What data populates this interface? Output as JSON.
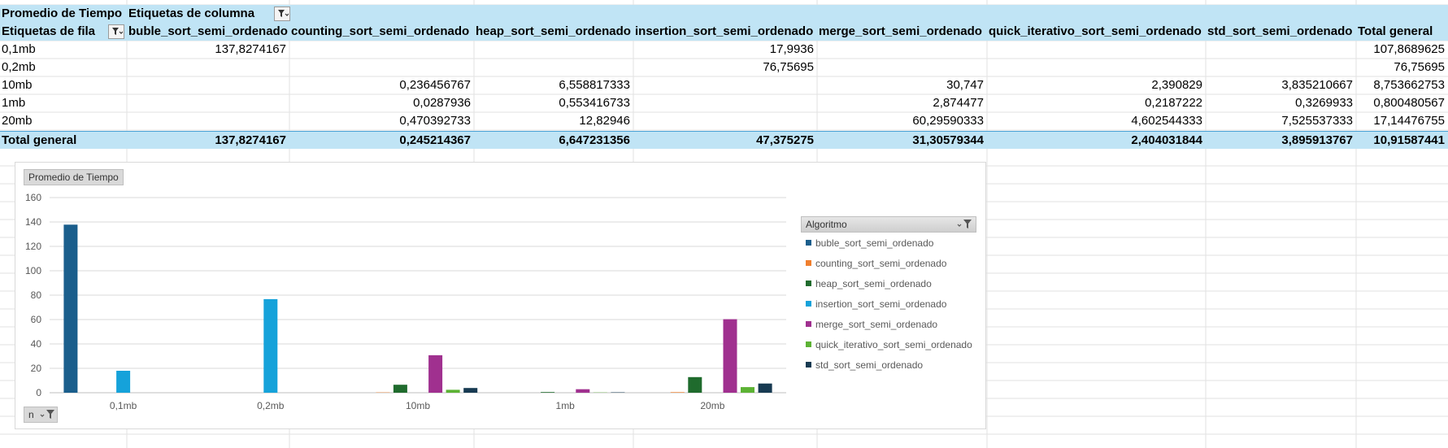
{
  "pivot": {
    "value_field": "Promedio de Tiempo",
    "column_labels_caption": "Etiquetas de columna",
    "row_labels_caption": "Etiquetas de fila",
    "columns": [
      "buble_sort_semi_ordenado",
      "counting_sort_semi_ordenado",
      "heap_sort_semi_ordenado",
      "insertion_sort_semi_ordenado",
      "merge_sort_semi_ordenado",
      "quick_iterativo_sort_semi_ordenado",
      "std_sort_semi_ordenado",
      "Total general"
    ],
    "rows": [
      {
        "label": "0,1mb",
        "values": [
          "137,8274167",
          "",
          "",
          "17,9936",
          "",
          "",
          "",
          "107,8689625"
        ]
      },
      {
        "label": "0,2mb",
        "values": [
          "",
          "",
          "",
          "76,75695",
          "",
          "",
          "",
          "76,75695"
        ]
      },
      {
        "label": "10mb",
        "values": [
          "",
          "0,236456767",
          "6,558817333",
          "",
          "30,747",
          "2,390829",
          "3,835210667",
          "8,753662753"
        ]
      },
      {
        "label": "1mb",
        "values": [
          "",
          "0,0287936",
          "0,553416733",
          "",
          "2,874477",
          "0,2187222",
          "0,3269933",
          "0,800480567"
        ]
      },
      {
        "label": "20mb",
        "values": [
          "",
          "0,470392733",
          "12,82946",
          "",
          "60,29590333",
          "4,602544333",
          "7,525537333",
          "17,14476755"
        ]
      }
    ],
    "total": {
      "label": "Total general",
      "values": [
        "137,8274167",
        "0,245214367",
        "6,647231356",
        "47,375275",
        "31,30579344",
        "2,404031844",
        "3,895913767",
        "10,91587441"
      ]
    }
  },
  "chart_data": {
    "type": "bar",
    "value_chip": "Promedio de Tiempo",
    "legend_title": "Algoritmo",
    "axis_filter_chip": "n",
    "categories": [
      "0,1mb",
      "0,2mb",
      "10mb",
      "1mb",
      "20mb"
    ],
    "ylim": [
      0,
      160
    ],
    "yticks": [
      0,
      20,
      40,
      60,
      80,
      100,
      120,
      140,
      160
    ],
    "grid": true,
    "legend_position": "right",
    "series": [
      {
        "name": "buble_sort_semi_ordenado",
        "color": "#1a5e8c",
        "values": [
          137.8274167,
          null,
          null,
          null,
          null
        ]
      },
      {
        "name": "counting_sort_semi_ordenado",
        "color": "#f07f2e",
        "values": [
          null,
          null,
          0.236456767,
          0.0287936,
          0.470392733
        ]
      },
      {
        "name": "heap_sort_semi_ordenado",
        "color": "#1f6b2d",
        "values": [
          null,
          null,
          6.558817333,
          0.553416733,
          12.82946
        ]
      },
      {
        "name": "insertion_sort_semi_ordenado",
        "color": "#15a2da",
        "values": [
          17.9936,
          76.75695,
          null,
          null,
          null
        ]
      },
      {
        "name": "merge_sort_semi_ordenado",
        "color": "#a0308f",
        "values": [
          null,
          null,
          30.747,
          2.874477,
          60.29590333
        ]
      },
      {
        "name": "quick_iterativo_sort_semi_ordenado",
        "color": "#5cb234",
        "values": [
          null,
          null,
          2.390829,
          0.2187222,
          4.602544333
        ]
      },
      {
        "name": "std_sort_semi_ordenado",
        "color": "#173a52",
        "values": [
          null,
          null,
          3.835210667,
          0.3269933,
          7.525537333
        ]
      }
    ]
  }
}
